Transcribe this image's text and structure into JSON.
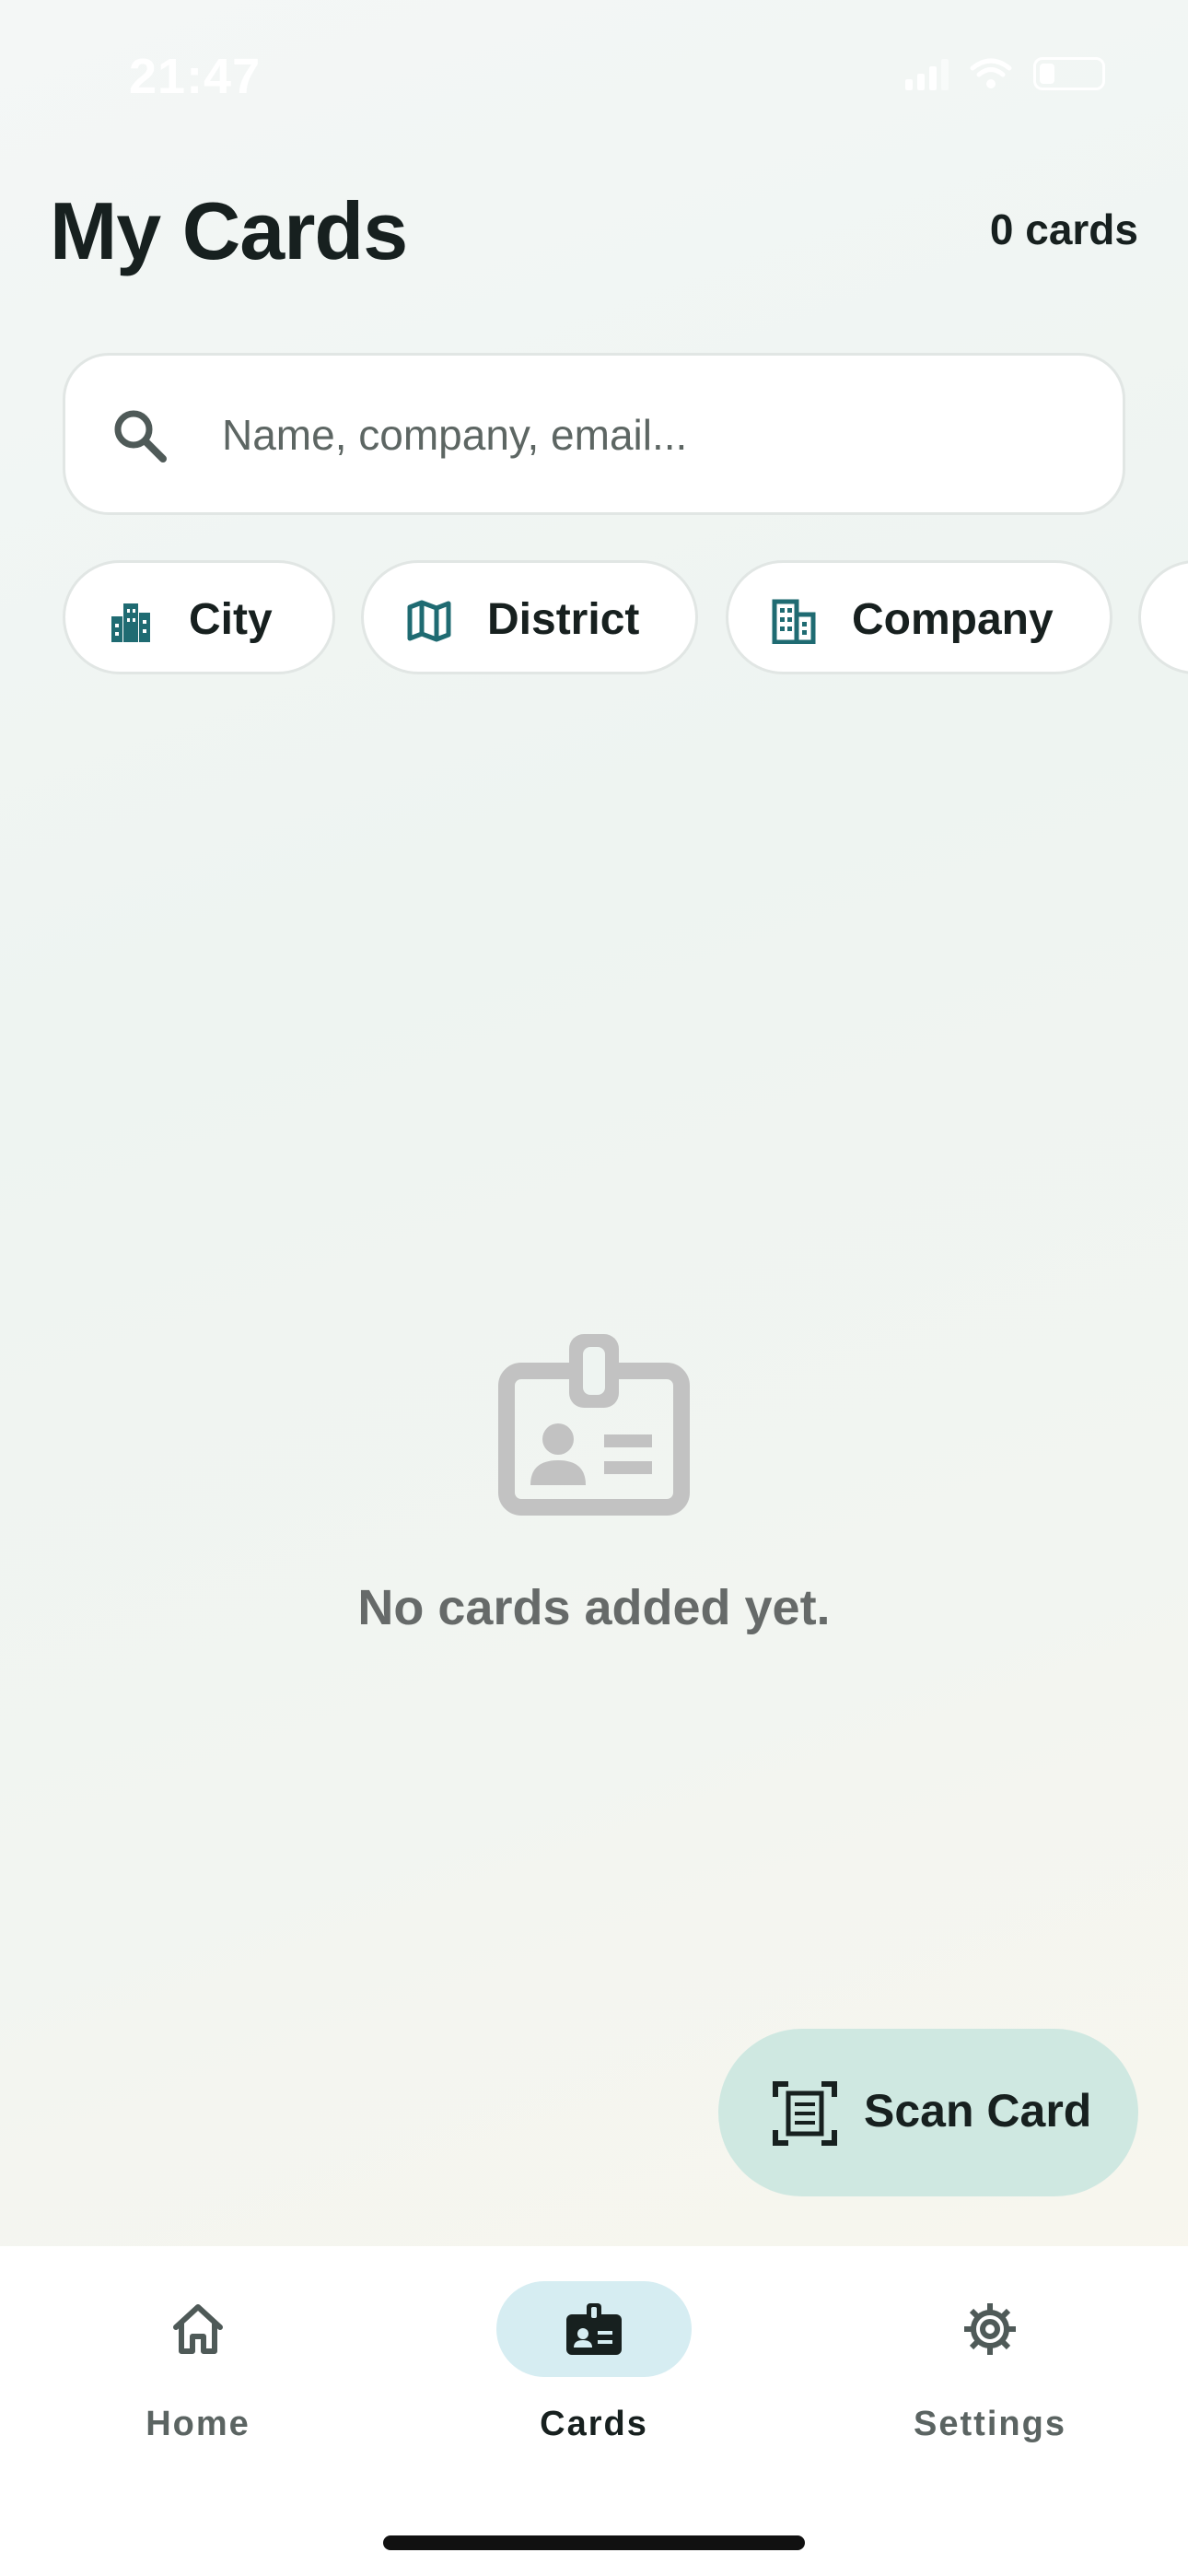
{
  "status_bar": {
    "time": "21:47"
  },
  "header": {
    "title": "My Cards",
    "count": "0 cards"
  },
  "search": {
    "placeholder": "Name, company, email..."
  },
  "filters": [
    {
      "label": "City",
      "icon": "city-icon"
    },
    {
      "label": "District",
      "icon": "map-icon"
    },
    {
      "label": "Company",
      "icon": "building-icon"
    }
  ],
  "empty_state": {
    "message": "No cards added yet.",
    "icon": "id-badge-icon"
  },
  "fab": {
    "label": "Scan Card",
    "icon": "document-scan-icon"
  },
  "bottom_nav": {
    "items": [
      {
        "label": "Home",
        "icon": "home-icon",
        "active": false
      },
      {
        "label": "Cards",
        "icon": "id-badge-icon",
        "active": true
      },
      {
        "label": "Settings",
        "icon": "gear-icon",
        "active": false
      }
    ]
  },
  "colors": {
    "accent_teal": "#1f6b72",
    "active_nav_bg": "#d6edf2",
    "fab_bg": "#cfe8e1",
    "text_primary": "#17201f",
    "empty_icon": "#c2c2c2"
  }
}
